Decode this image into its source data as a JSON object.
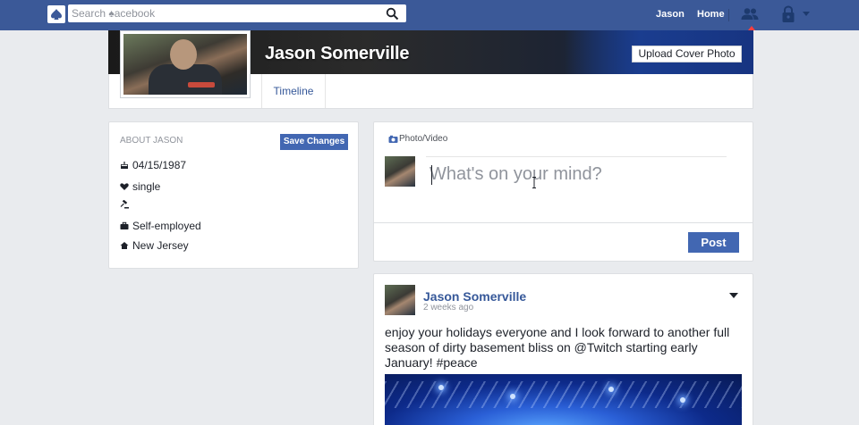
{
  "topbar": {
    "search_placeholder": "Search ♠acebook",
    "user_link": "Jason",
    "home_link": "Home"
  },
  "profile": {
    "name": "Jason Somerville",
    "upload_cover_label": "Upload Cover Photo",
    "tabs": [
      {
        "label": "Timeline"
      }
    ]
  },
  "about": {
    "title": "ABOUT JASON",
    "save_label": "Save Changes",
    "items": [
      {
        "icon": "birthday-cake-icon",
        "text": "04/15/1987"
      },
      {
        "icon": "heart-icon",
        "text": "single"
      },
      {
        "icon": "gavel-icon",
        "text": ""
      },
      {
        "icon": "briefcase-icon",
        "text": "Self-employed"
      },
      {
        "icon": "home-icon",
        "text": "New Jersey"
      }
    ]
  },
  "composer": {
    "photo_tab": "Photo/Video",
    "placeholder": "What's on your mind?",
    "value": "",
    "post_label": "Post"
  },
  "story": {
    "author": "Jason Somerville",
    "time": "2 weeks ago",
    "text": "enjoy your holidays everyone and I look forward to another full season of dirty basement bliss on @Twitch starting early January! #peace"
  },
  "colors": {
    "brand": "#3b5998",
    "button": "#4267b2",
    "link": "#365899",
    "notification": "#fa3e3e"
  }
}
